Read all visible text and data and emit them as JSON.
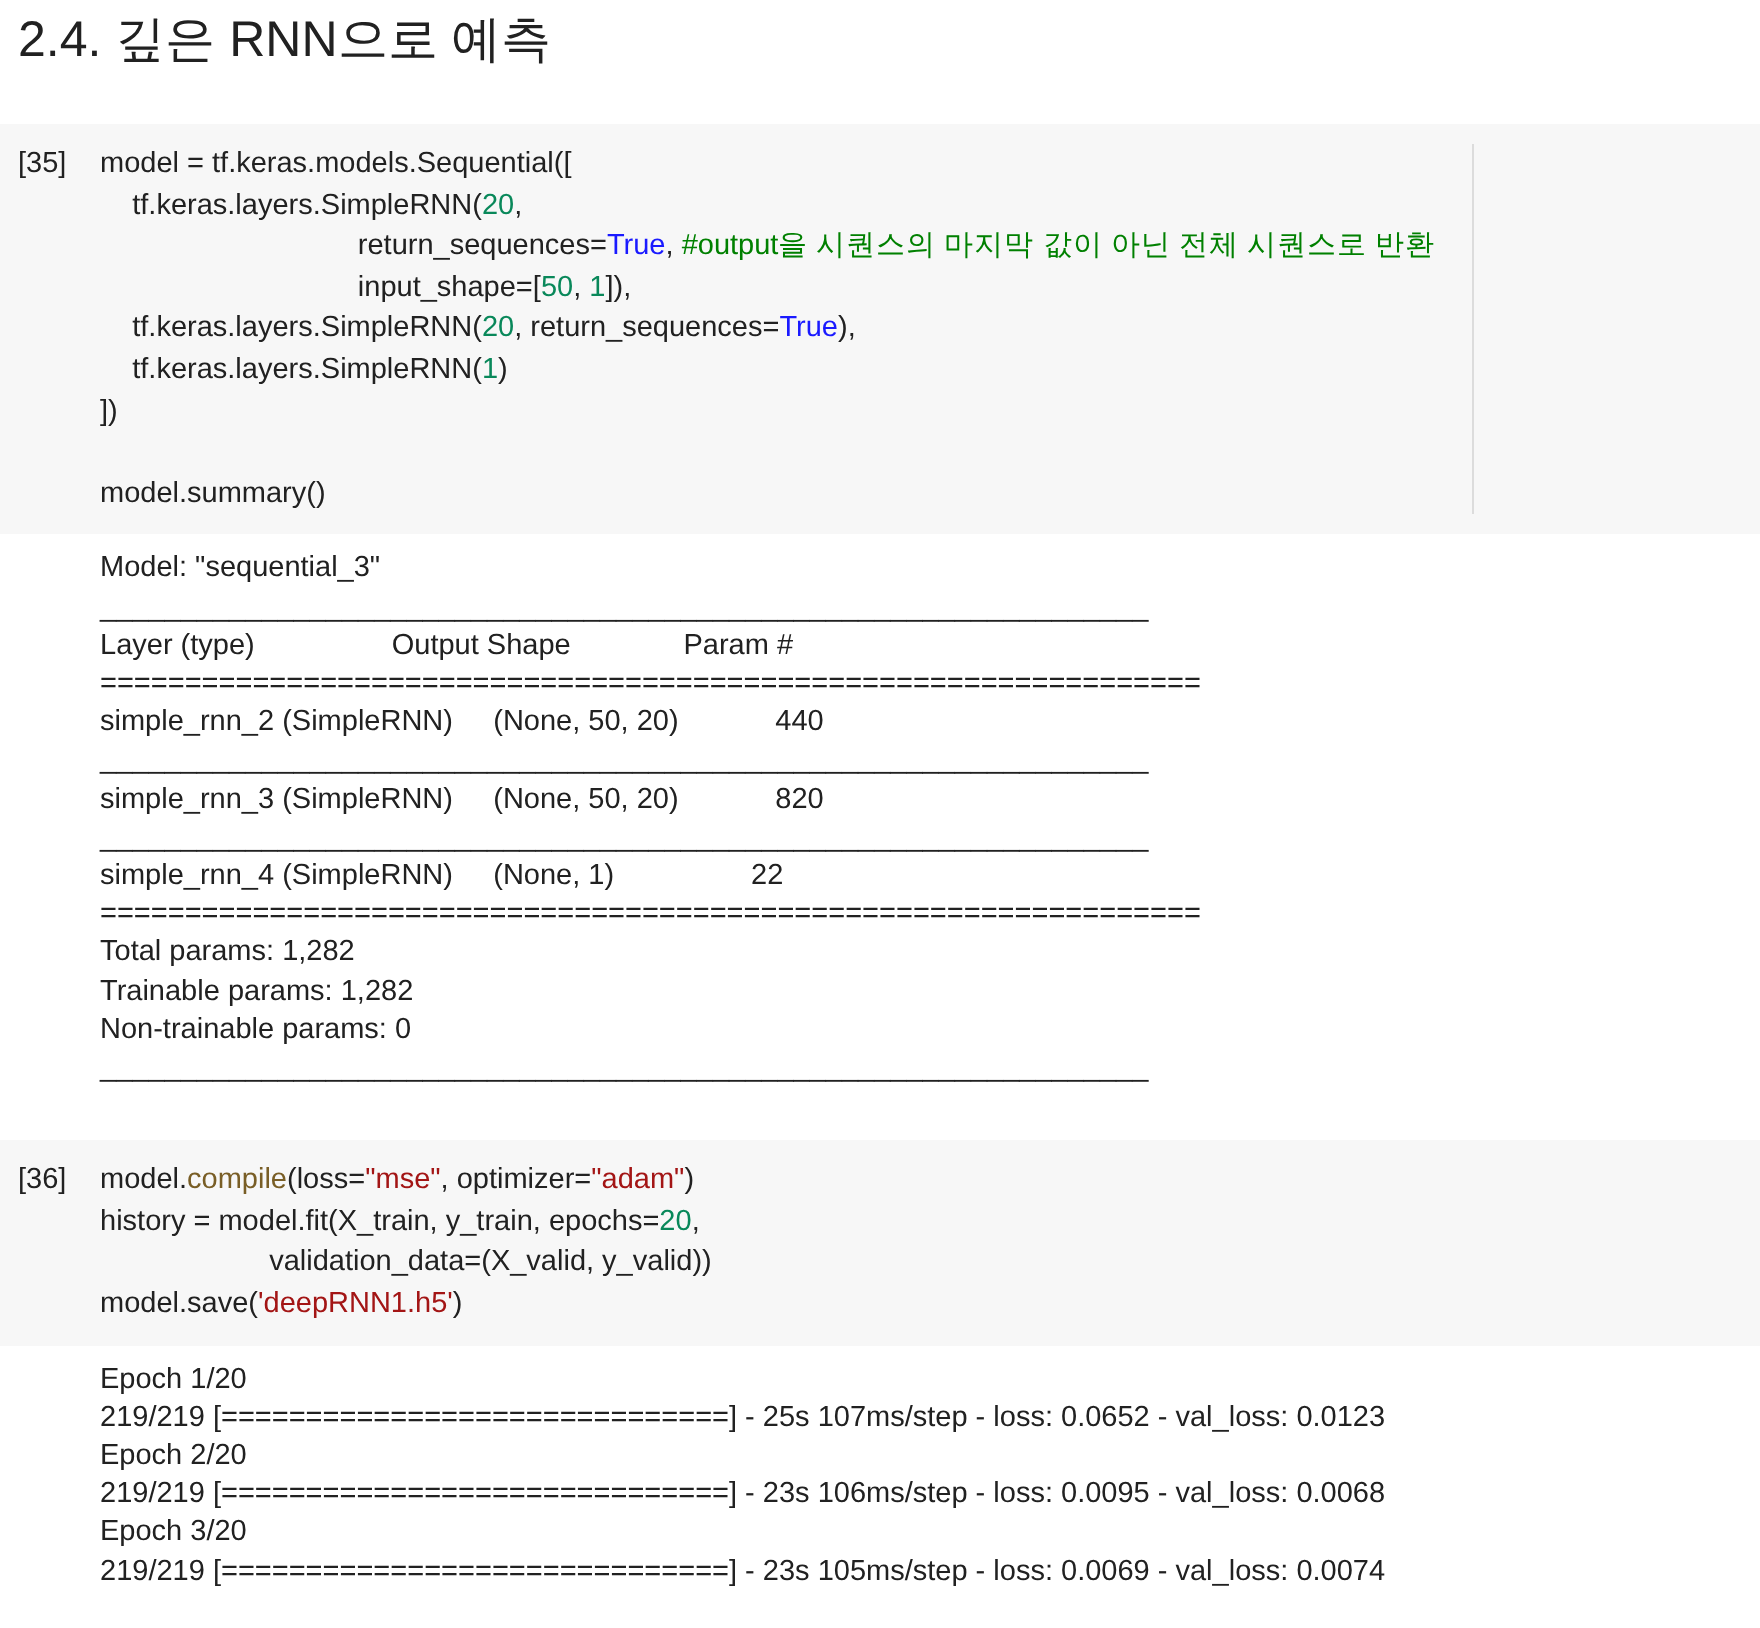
{
  "heading": "2.4. 깊은 RNN으로 예측",
  "cells": [
    {
      "prompt": "[35]",
      "ruler": true,
      "code_blocks": [
        [
          [
            {
              "kind": "plain",
              "text": "model = tf.keras.models.Sequential(["
            }
          ],
          [
            {
              "kind": "plain",
              "text": "    tf.keras.layers.SimpleRNN("
            },
            {
              "kind": "number",
              "text": "20"
            },
            {
              "kind": "plain",
              "text": ","
            }
          ],
          [
            {
              "kind": "plain",
              "text": "                                return_sequences="
            },
            {
              "kind": "keyword",
              "text": "True"
            },
            {
              "kind": "plain",
              "text": ", "
            },
            {
              "kind": "comment",
              "text": "#output을 시퀀스의 마지막 값이 아닌 전체 시퀀스로 반환"
            }
          ],
          [
            {
              "kind": "plain",
              "text": "                                input_shape=["
            },
            {
              "kind": "number",
              "text": "50"
            },
            {
              "kind": "plain",
              "text": ", "
            },
            {
              "kind": "number",
              "text": "1"
            },
            {
              "kind": "plain",
              "text": "]),"
            }
          ],
          [
            {
              "kind": "plain",
              "text": "    tf.keras.layers.SimpleRNN("
            },
            {
              "kind": "number",
              "text": "20"
            },
            {
              "kind": "plain",
              "text": ", return_sequences="
            },
            {
              "kind": "keyword",
              "text": "True"
            },
            {
              "kind": "plain",
              "text": "),"
            }
          ],
          [
            {
              "kind": "plain",
              "text": "    tf.keras.layers.SimpleRNN("
            },
            {
              "kind": "number",
              "text": "1"
            },
            {
              "kind": "plain",
              "text": ")"
            }
          ],
          [
            {
              "kind": "plain",
              "text": "])"
            }
          ]
        ],
        [
          [
            {
              "kind": "plain",
              "text": "model.summary()"
            }
          ]
        ]
      ],
      "output": [
        "Model: \"sequential_3\"",
        "_________________________________________________________________",
        "Layer (type)                 Output Shape              Param #",
        "=================================================================",
        "simple_rnn_2 (SimpleRNN)     (None, 50, 20)            440",
        "_________________________________________________________________",
        "simple_rnn_3 (SimpleRNN)     (None, 50, 20)            820",
        "_________________________________________________________________",
        "simple_rnn_4 (SimpleRNN)     (None, 1)                 22",
        "=================================================================",
        "Total params: 1,282",
        "Trainable params: 1,282",
        "Non-trainable params: 0",
        "_________________________________________________________________"
      ]
    },
    {
      "prompt": "[36]",
      "ruler": false,
      "code_blocks": [
        [
          [
            {
              "kind": "plain",
              "text": "model."
            },
            {
              "kind": "function",
              "text": "compile"
            },
            {
              "kind": "plain",
              "text": "(loss="
            },
            {
              "kind": "string",
              "text": "\"mse\""
            },
            {
              "kind": "plain",
              "text": ", optimizer="
            },
            {
              "kind": "string",
              "text": "\"adam\""
            },
            {
              "kind": "plain",
              "text": ")"
            }
          ],
          [
            {
              "kind": "plain",
              "text": "history = model.fit(X_train, y_train, epochs="
            },
            {
              "kind": "number",
              "text": "20"
            },
            {
              "kind": "plain",
              "text": ","
            }
          ],
          [
            {
              "kind": "plain",
              "text": "                     validation_data=(X_valid, y_valid))"
            }
          ],
          [
            {
              "kind": "plain",
              "text": "model.save("
            },
            {
              "kind": "string",
              "text": "'deepRNN1.h5'"
            },
            {
              "kind": "plain",
              "text": ")"
            }
          ]
        ]
      ],
      "output": [
        "Epoch 1/20",
        "219/219 [==============================] - 25s 107ms/step - loss: 0.0652 - val_loss: 0.0123",
        "Epoch 2/20",
        "219/219 [==============================] - 23s 106ms/step - loss: 0.0095 - val_loss: 0.0068",
        "Epoch 3/20",
        "219/219 [==============================] - 23s 105ms/step - loss: 0.0069 - val_loss: 0.0074"
      ]
    }
  ]
}
